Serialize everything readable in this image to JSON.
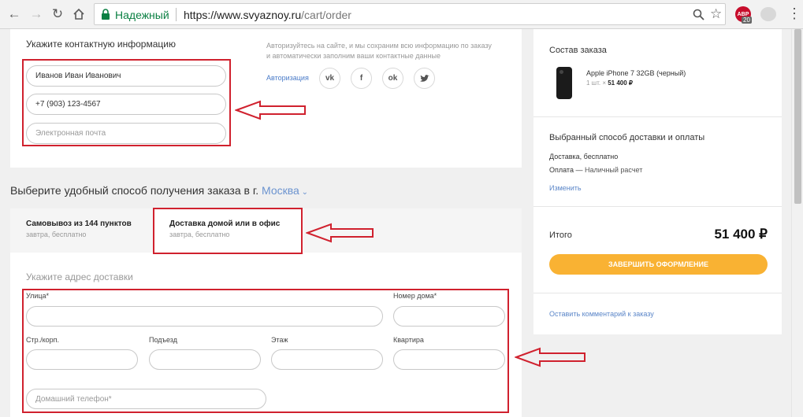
{
  "browser": {
    "secure_label": "Надежный",
    "url_host": "https://www.svyaznoy.ru",
    "url_path": "/cart/order",
    "abp_label": "ABP",
    "abp_count": "20"
  },
  "contact": {
    "title": "Укажите контактную информацию",
    "name_value": "Иванов Иван Иванович",
    "phone_value": "+7 (903) 123-4567",
    "email_placeholder": "Электронная почта",
    "auth_text": "Авторизуйтесь на сайте, и мы сохраним всю информацию по заказу и автоматически заполним ваши контактные данные",
    "auth_link": "Авторизация",
    "social": [
      "vk",
      "f",
      "ok",
      "tw"
    ]
  },
  "delivery": {
    "heading": "Выберите удобный способ получения заказа в г.",
    "city": "Москва",
    "tabs": [
      {
        "title": "Самовывоз из 144 пунктов",
        "sub": "завтра, бесплатно"
      },
      {
        "title": "Доставка домой или в офис",
        "sub": "завтра, бесплатно"
      }
    ],
    "address_title": "Укажите адрес доставки",
    "labels": {
      "street": "Улица*",
      "house": "Номер дома*",
      "building": "Стр./корп.",
      "entrance": "Подъезд",
      "floor": "Этаж",
      "apartment": "Квартира"
    },
    "home_phone_placeholder": "Домашний телефон*"
  },
  "summary": {
    "order_title": "Состав заказа",
    "product_name": "Apple iPhone 7 32GB (черный)",
    "product_qty": "1 шт. × ",
    "product_price": "51 400 ₽",
    "method_title": "Выбранный способ доставки и оплаты",
    "delivery_line": "Доставка, бесплатно",
    "payment_label": "Оплата —",
    "payment_value": " Наличный расчет",
    "change_link": "Изменить",
    "total_label": "Итого",
    "total_value": "51 400 ₽",
    "finish_button": "ЗАВЕРШИТЬ ОФОРМЛЕНИЕ",
    "comment_link": "Оставить комментарий к заказу"
  },
  "colors": {
    "annotation_red": "#d0212e",
    "accent_orange": "#f9b233",
    "link_blue": "#5b86c8",
    "secure_green": "#0b8043"
  }
}
